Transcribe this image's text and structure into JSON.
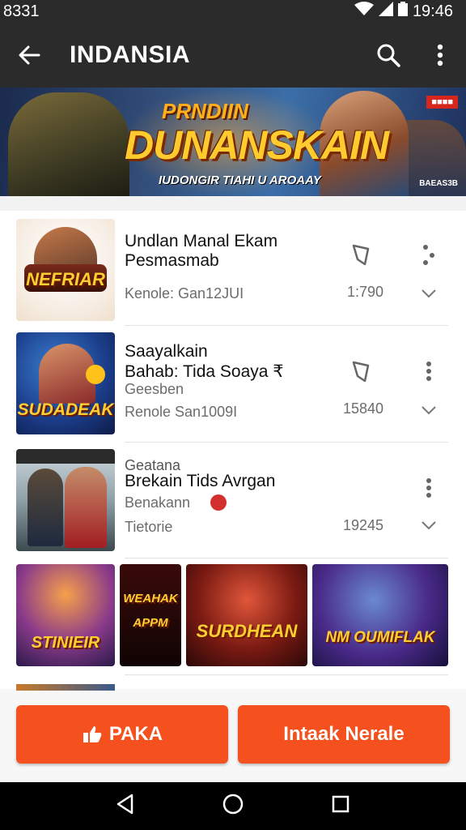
{
  "status_bar": {
    "time_left": "8331",
    "time_right": "19:46"
  },
  "app_bar": {
    "title": "INDANSIA"
  },
  "banner": {
    "line1": "PRNDIIN",
    "line2": "DUNANSKAIN",
    "line3": "IUDONGIR TIAHI U AROAAY",
    "badge": "",
    "corner": "BAEAS3B"
  },
  "items": [
    {
      "title1": "Undlan Manal Ekam",
      "title2": "Pesmasmab",
      "sub1": "",
      "sub2": "Kenole:  Gan12JUI",
      "count": "1:790",
      "thumb_text": "NEFRIAR"
    },
    {
      "title1": "Saayalkain",
      "title2": "Bahab: Tida Soaya ₹",
      "sub1": "Geesben",
      "sub2": "Renole  San1009I",
      "count": "15840",
      "thumb_text": "SUDADEAK"
    },
    {
      "title1": "Geatana",
      "title2": "Brekain Tids Avrgan",
      "sub1": "Benakann",
      "sub2": "Tietorie",
      "count": "19245",
      "thumb_text": ""
    }
  ],
  "tiles": [
    {
      "label": "STINIEIR"
    },
    {
      "label": "WEAHAK APPM"
    },
    {
      "label": "SURDHEAN"
    },
    {
      "label": "NM OUMIFLAK"
    }
  ],
  "actions": {
    "left_label": "PAKA",
    "right_label": "Intaak Nerale"
  },
  "colors": {
    "accent": "#f4511e",
    "app_bar": "#2b2b2b"
  }
}
